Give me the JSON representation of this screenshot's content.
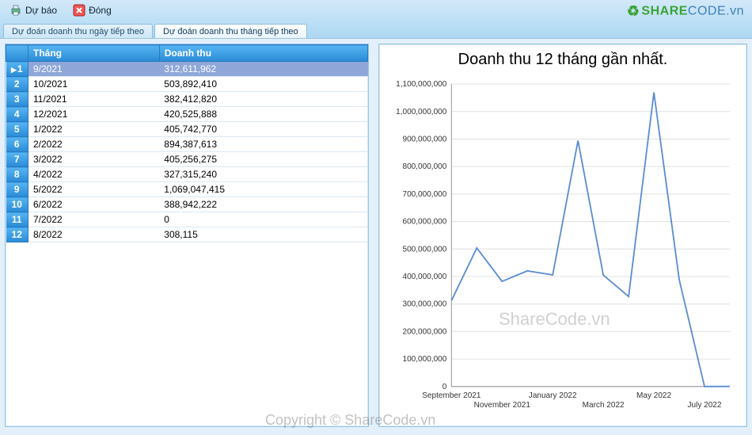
{
  "toolbar": {
    "forecast_label": "Dự báo",
    "close_label": "Đóng"
  },
  "tabs": [
    {
      "label": "Dự đoán doanh thu ngày tiếp theo",
      "active": false
    },
    {
      "label": "Dự đoán doanh thu tháng tiếp theo",
      "active": true
    }
  ],
  "table": {
    "columns": [
      "Tháng",
      "Doanh thu"
    ],
    "rows": [
      {
        "n": "1",
        "thang": "9/2021",
        "doanhthu": "312,611,962",
        "selected": true
      },
      {
        "n": "2",
        "thang": "10/2021",
        "doanhthu": "503,892,410"
      },
      {
        "n": "3",
        "thang": "11/2021",
        "doanhthu": "382,412,820"
      },
      {
        "n": "4",
        "thang": "12/2021",
        "doanhthu": "420,525,888"
      },
      {
        "n": "5",
        "thang": "1/2022",
        "doanhthu": "405,742,770"
      },
      {
        "n": "6",
        "thang": "2/2022",
        "doanhthu": "894,387,613"
      },
      {
        "n": "7",
        "thang": "3/2022",
        "doanhthu": "405,256,275"
      },
      {
        "n": "8",
        "thang": "4/2022",
        "doanhthu": "327,315,240"
      },
      {
        "n": "9",
        "thang": "5/2022",
        "doanhthu": "1,069,047,415"
      },
      {
        "n": "10",
        "thang": "6/2022",
        "doanhthu": "388,942,222"
      },
      {
        "n": "11",
        "thang": "7/2022",
        "doanhthu": "0"
      },
      {
        "n": "12",
        "thang": "8/2022",
        "doanhthu": "308,115"
      }
    ]
  },
  "chart_data": {
    "type": "line",
    "title": "Doanh thu 12 tháng gần nhất.",
    "xlabel": "",
    "ylabel": "",
    "ylim": [
      0,
      1100000000
    ],
    "yticks": [
      0,
      100000000,
      200000000,
      300000000,
      400000000,
      500000000,
      600000000,
      700000000,
      800000000,
      900000000,
      1000000000,
      1100000000
    ],
    "ytick_labels": [
      "0",
      "100,000,000",
      "200,000,000",
      "300,000,000",
      "400,000,000",
      "500,000,000",
      "600,000,000",
      "700,000,000",
      "800,000,000",
      "900,000,000",
      "1,000,000,000",
      "1,100,000,000"
    ],
    "categories": [
      "9/2021",
      "10/2021",
      "11/2021",
      "12/2021",
      "1/2022",
      "2/2022",
      "3/2022",
      "4/2022",
      "5/2022",
      "6/2022",
      "7/2022",
      "8/2022"
    ],
    "x_tick_labels_shown": [
      "September 2021",
      "November 2021",
      "January 2022",
      "March 2022",
      "May 2022",
      "July 2022"
    ],
    "values": [
      312611962,
      503892410,
      382412820,
      420525888,
      405742770,
      894387613,
      405256275,
      327315240,
      1069047415,
      388942222,
      0,
      308115
    ]
  },
  "watermarks": {
    "center": "ShareCode.vn",
    "bottom": "Copyright © ShareCode.vn"
  },
  "logo": {
    "part1": "SHARE",
    "part2": "CODE",
    "suffix": ".vn"
  }
}
